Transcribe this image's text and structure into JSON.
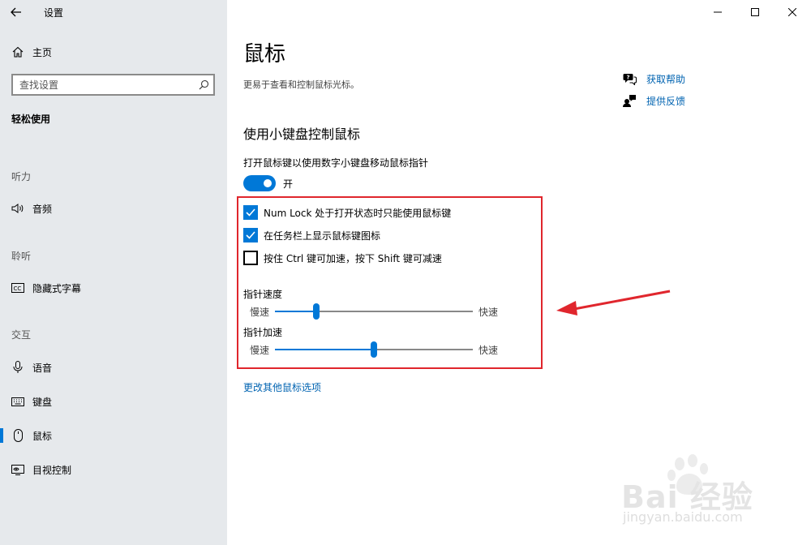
{
  "window": {
    "app_title": "设置"
  },
  "sidebar": {
    "home_label": "主页",
    "search_placeholder": "查找设置",
    "category": "轻松使用",
    "sections": {
      "hearing": "听力",
      "listening": "聆听",
      "interaction": "交互"
    },
    "items": {
      "audio": "音频",
      "captions": "隐藏式字幕",
      "speech": "语音",
      "keyboard": "键盘",
      "mouse": "鼠标",
      "eye_control": "目视控制"
    },
    "active_item": "mouse"
  },
  "main": {
    "title": "鼠标",
    "description": "更易于查看和控制鼠标光标。",
    "help": {
      "get_help": "获取帮助",
      "give_feedback": "提供反馈"
    },
    "section_title": "使用小键盘控制鼠标",
    "mouse_keys": {
      "caption": "打开鼠标键以使用数字小键盘移动鼠标指针",
      "state_label": "开",
      "on": true
    },
    "checkboxes": [
      {
        "label": "Num Lock 处于打开状态时只能使用鼠标键",
        "checked": true
      },
      {
        "label": "在任务栏上显示鼠标键图标",
        "checked": true
      },
      {
        "label": "按住 Ctrl 键可加速，按下 Shift 键可减速",
        "checked": false
      }
    ],
    "sliders": {
      "pointer_speed": {
        "title": "指针速度",
        "min_label": "慢速",
        "max_label": "快速",
        "value": 0.21
      },
      "pointer_acceleration": {
        "title": "指针加速",
        "min_label": "慢速",
        "max_label": "快速",
        "value": 0.5
      }
    },
    "more_options_link": "更改其他鼠标选项"
  },
  "watermark": {
    "brand": "Bai 经验",
    "site": "jingyan.baidu.com"
  },
  "colors": {
    "accent": "#0078d7",
    "link": "#0063b1",
    "highlight": "#e0262d",
    "sidebar_bg": "#e6e9ec"
  }
}
